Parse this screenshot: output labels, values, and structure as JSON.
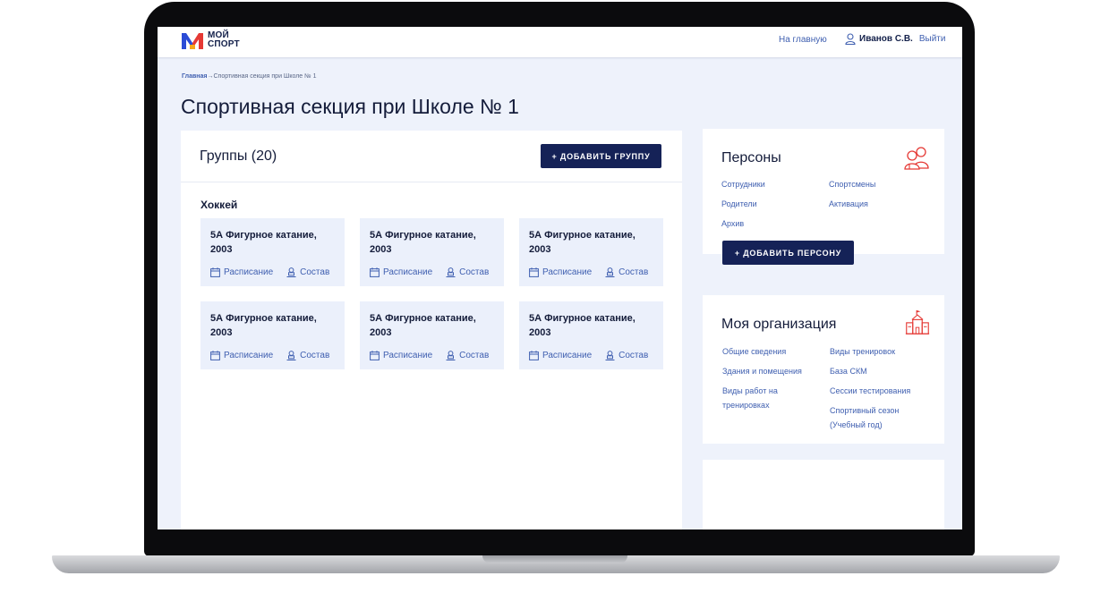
{
  "header": {
    "brand_line1": "МОЙ",
    "brand_line2": "СПОРТ",
    "home_link": "На главную",
    "user_name": "Иванов С.В.",
    "logout": "Выйти",
    "logo_colors": [
      "#e53935",
      "#2b4bd6",
      "#f6a61b",
      "#2bb673"
    ]
  },
  "breadcrumb": {
    "home": "Главная",
    "separator": "→",
    "current": "Спортивная секция при Школе № 1"
  },
  "page_title": "Спортивная секция при Школе № 1",
  "groups": {
    "title": "Группы (20)",
    "add_button": "+ ДОБАВИТЬ ГРУППУ",
    "sport": "Хоккей",
    "cards": [
      {
        "title": "5А Фигурное катание, 2003",
        "schedule": "Расписание",
        "roster": "Состав"
      },
      {
        "title": "5А Фигурное катание, 2003",
        "schedule": "Расписание",
        "roster": "Состав"
      },
      {
        "title": "5А Фигурное катание, 2003",
        "schedule": "Расписание",
        "roster": "Состав"
      },
      {
        "title": "5А Фигурное катание, 2003",
        "schedule": "Расписание",
        "roster": "Состав"
      },
      {
        "title": "5А Фигурное катание, 2003",
        "schedule": "Расписание",
        "roster": "Состав"
      },
      {
        "title": "5А Фигурное катание, 2003",
        "schedule": "Расписание",
        "roster": "Состав"
      }
    ]
  },
  "persons": {
    "title": "Персоны",
    "icon": "people-icon",
    "links": [
      "Сотрудники",
      "Спортсмены",
      "Родители",
      "Активация",
      "Архив"
    ],
    "add_button": "+ ДОБАВИТЬ ПЕРСОНУ"
  },
  "organization": {
    "title": "Моя организация",
    "icon": "building-icon",
    "links": [
      "Общие сведения",
      "Виды тренировок",
      "Здания и помещения",
      "База СКМ",
      "Виды работ на тренировках",
      "Сессии тестирования",
      "Спортивный сезон (Учебный год)"
    ]
  },
  "colors": {
    "accent": "#152257",
    "link": "#3f5fb0",
    "icon_red": "#e53935",
    "page_bg": "#eef2fb",
    "card_bg": "#ebf0fb"
  }
}
